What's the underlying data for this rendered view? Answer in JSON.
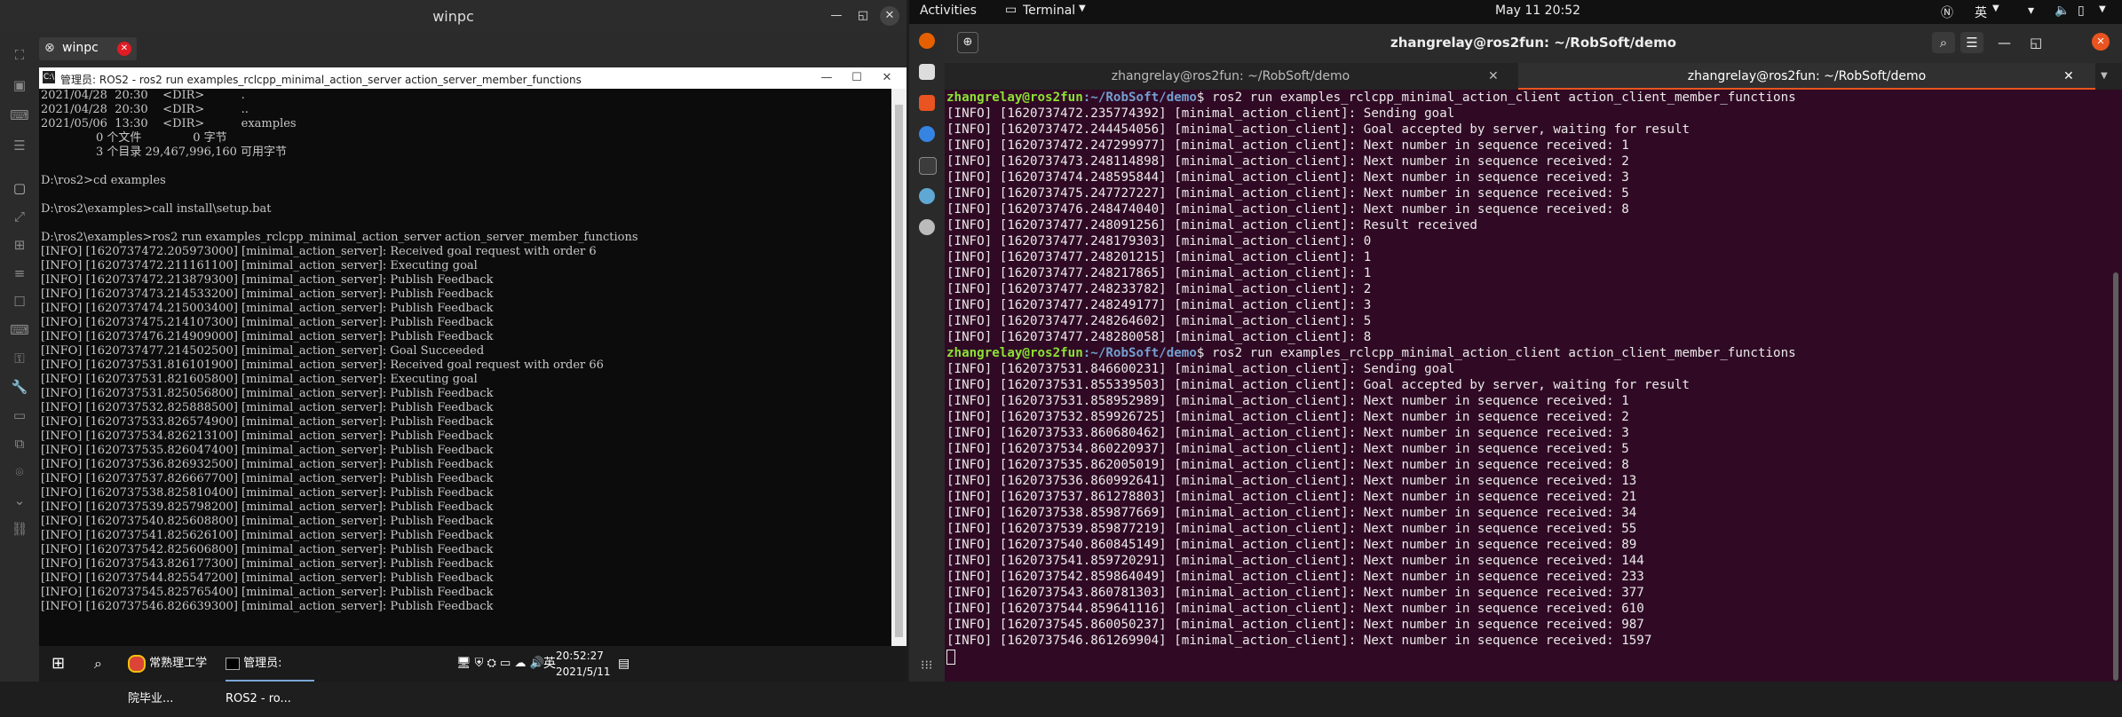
{
  "left_window": {
    "title": "winpc",
    "tab_label": "winpc",
    "cmd": {
      "title": "管理员: ROS2 - ros2  run examples_rclcpp_minimal_action_server action_server_member_functions",
      "lines": [
        "2021/04/28  20:30    <DIR>          .",
        "2021/04/28  20:30    <DIR>          ..",
        "2021/05/06  13:30    <DIR>          examples",
        "               0 个文件              0 字节",
        "               3 个目录 29,467,996,160 可用字节",
        "",
        "D:\\ros2>cd examples",
        "",
        "D:\\ros2\\examples>call install\\setup.bat",
        "",
        "D:\\ros2\\examples>ros2 run examples_rclcpp_minimal_action_server action_server_member_functions",
        "[INFO] [1620737472.205973000] [minimal_action_server]: Received goal request with order 6",
        "[INFO] [1620737472.211161100] [minimal_action_server]: Executing goal",
        "[INFO] [1620737472.213879300] [minimal_action_server]: Publish Feedback",
        "[INFO] [1620737473.214533200] [minimal_action_server]: Publish Feedback",
        "[INFO] [1620737474.215003400] [minimal_action_server]: Publish Feedback",
        "[INFO] [1620737475.214107300] [minimal_action_server]: Publish Feedback",
        "[INFO] [1620737476.214909000] [minimal_action_server]: Publish Feedback",
        "[INFO] [1620737477.214502500] [minimal_action_server]: Goal Succeeded",
        "[INFO] [1620737531.816101900] [minimal_action_server]: Received goal request with order 66",
        "[INFO] [1620737531.821605800] [minimal_action_server]: Executing goal",
        "[INFO] [1620737531.825056800] [minimal_action_server]: Publish Feedback",
        "[INFO] [1620737532.825888500] [minimal_action_server]: Publish Feedback",
        "[INFO] [1620737533.826574900] [minimal_action_server]: Publish Feedback",
        "[INFO] [1620737534.826213100] [minimal_action_server]: Publish Feedback",
        "[INFO] [1620737535.826047400] [minimal_action_server]: Publish Feedback",
        "[INFO] [1620737536.826932500] [minimal_action_server]: Publish Feedback",
        "[INFO] [1620737537.826667700] [minimal_action_server]: Publish Feedback",
        "[INFO] [1620737538.825810400] [minimal_action_server]: Publish Feedback",
        "[INFO] [1620737539.825798200] [minimal_action_server]: Publish Feedback",
        "[INFO] [1620737540.825608800] [minimal_action_server]: Publish Feedback",
        "[INFO] [1620737541.825626100] [minimal_action_server]: Publish Feedback",
        "[INFO] [1620737542.825606800] [minimal_action_server]: Publish Feedback",
        "[INFO] [1620737543.826177300] [minimal_action_server]: Publish Feedback",
        "[INFO] [1620737544.825547200] [minimal_action_server]: Publish Feedback",
        "[INFO] [1620737545.825765400] [minimal_action_server]: Publish Feedback",
        "[INFO] [1620737546.826639300] [minimal_action_server]: Publish Feedback"
      ]
    },
    "taskbar": {
      "chrome_label": "常熟理工学院毕业...",
      "cmd_label": "管理员: ROS2 - ro...",
      "ime": "英",
      "time": "20:52:27",
      "date": "2021/5/11"
    }
  },
  "ubuntu": {
    "activities": "Activities",
    "app_menu": "Terminal",
    "clock": "May 11  20:52",
    "ime": "英",
    "window_title": "zhangrelay@ros2fun: ~/RobSoft/demo",
    "tabs": [
      "zhangrelay@ros2fun: ~/RobSoft/demo",
      "zhangrelay@ros2fun: ~/RobSoft/demo"
    ],
    "prompt_user": "zhangrelay@ros2fun",
    "prompt_path": ":~/RobSoft/demo",
    "command": "$ ros2 run examples_rclcpp_minimal_action_client action_client_member_functions",
    "run1": [
      "[INFO] [1620737472.235774392] [minimal_action_client]: Sending goal",
      "[INFO] [1620737472.244454056] [minimal_action_client]: Goal accepted by server, waiting for result",
      "[INFO] [1620737472.247299977] [minimal_action_client]: Next number in sequence received: 1",
      "[INFO] [1620737473.248114898] [minimal_action_client]: Next number in sequence received: 2",
      "[INFO] [1620737474.248595844] [minimal_action_client]: Next number in sequence received: 3",
      "[INFO] [1620737475.247727227] [minimal_action_client]: Next number in sequence received: 5",
      "[INFO] [1620737476.248474040] [minimal_action_client]: Next number in sequence received: 8",
      "[INFO] [1620737477.248091256] [minimal_action_client]: Result received",
      "[INFO] [1620737477.248179303] [minimal_action_client]: 0",
      "[INFO] [1620737477.248201215] [minimal_action_client]: 1",
      "[INFO] [1620737477.248217865] [minimal_action_client]: 1",
      "[INFO] [1620737477.248233782] [minimal_action_client]: 2",
      "[INFO] [1620737477.248249177] [minimal_action_client]: 3",
      "[INFO] [1620737477.248264602] [minimal_action_client]: 5",
      "[INFO] [1620737477.248280058] [minimal_action_client]: 8"
    ],
    "run2": [
      "[INFO] [1620737531.846600231] [minimal_action_client]: Sending goal",
      "[INFO] [1620737531.855339503] [minimal_action_client]: Goal accepted by server, waiting for result",
      "[INFO] [1620737531.858952989] [minimal_action_client]: Next number in sequence received: 1",
      "[INFO] [1620737532.859926725] [minimal_action_client]: Next number in sequence received: 2",
      "[INFO] [1620737533.860680462] [minimal_action_client]: Next number in sequence received: 3",
      "[INFO] [1620737534.860220937] [minimal_action_client]: Next number in sequence received: 5",
      "[INFO] [1620737535.862005019] [minimal_action_client]: Next number in sequence received: 8",
      "[INFO] [1620737536.860992641] [minimal_action_client]: Next number in sequence received: 13",
      "[INFO] [1620737537.861278803] [minimal_action_client]: Next number in sequence received: 21",
      "[INFO] [1620737538.859877669] [minimal_action_client]: Next number in sequence received: 34",
      "[INFO] [1620737539.859877219] [minimal_action_client]: Next number in sequence received: 55",
      "[INFO] [1620737540.860845149] [minimal_action_client]: Next number in sequence received: 89",
      "[INFO] [1620737541.859720291] [minimal_action_client]: Next number in sequence received: 144",
      "[INFO] [1620737542.859864049] [minimal_action_client]: Next number in sequence received: 233",
      "[INFO] [1620737543.860781303] [minimal_action_client]: Next number in sequence received: 377",
      "[INFO] [1620737544.859641116] [minimal_action_client]: Next number in sequence received: 610",
      "[INFO] [1620737545.860050237] [minimal_action_client]: Next number in sequence received: 987",
      "[INFO] [1620737546.861269904] [minimal_action_client]: Next number in sequence received: 1597"
    ]
  },
  "colors": {
    "terminal_bg": "#300a24",
    "prompt_user": "#8ae234",
    "prompt_path": "#729fcf",
    "cmd_bg": "#0c0c0c"
  }
}
